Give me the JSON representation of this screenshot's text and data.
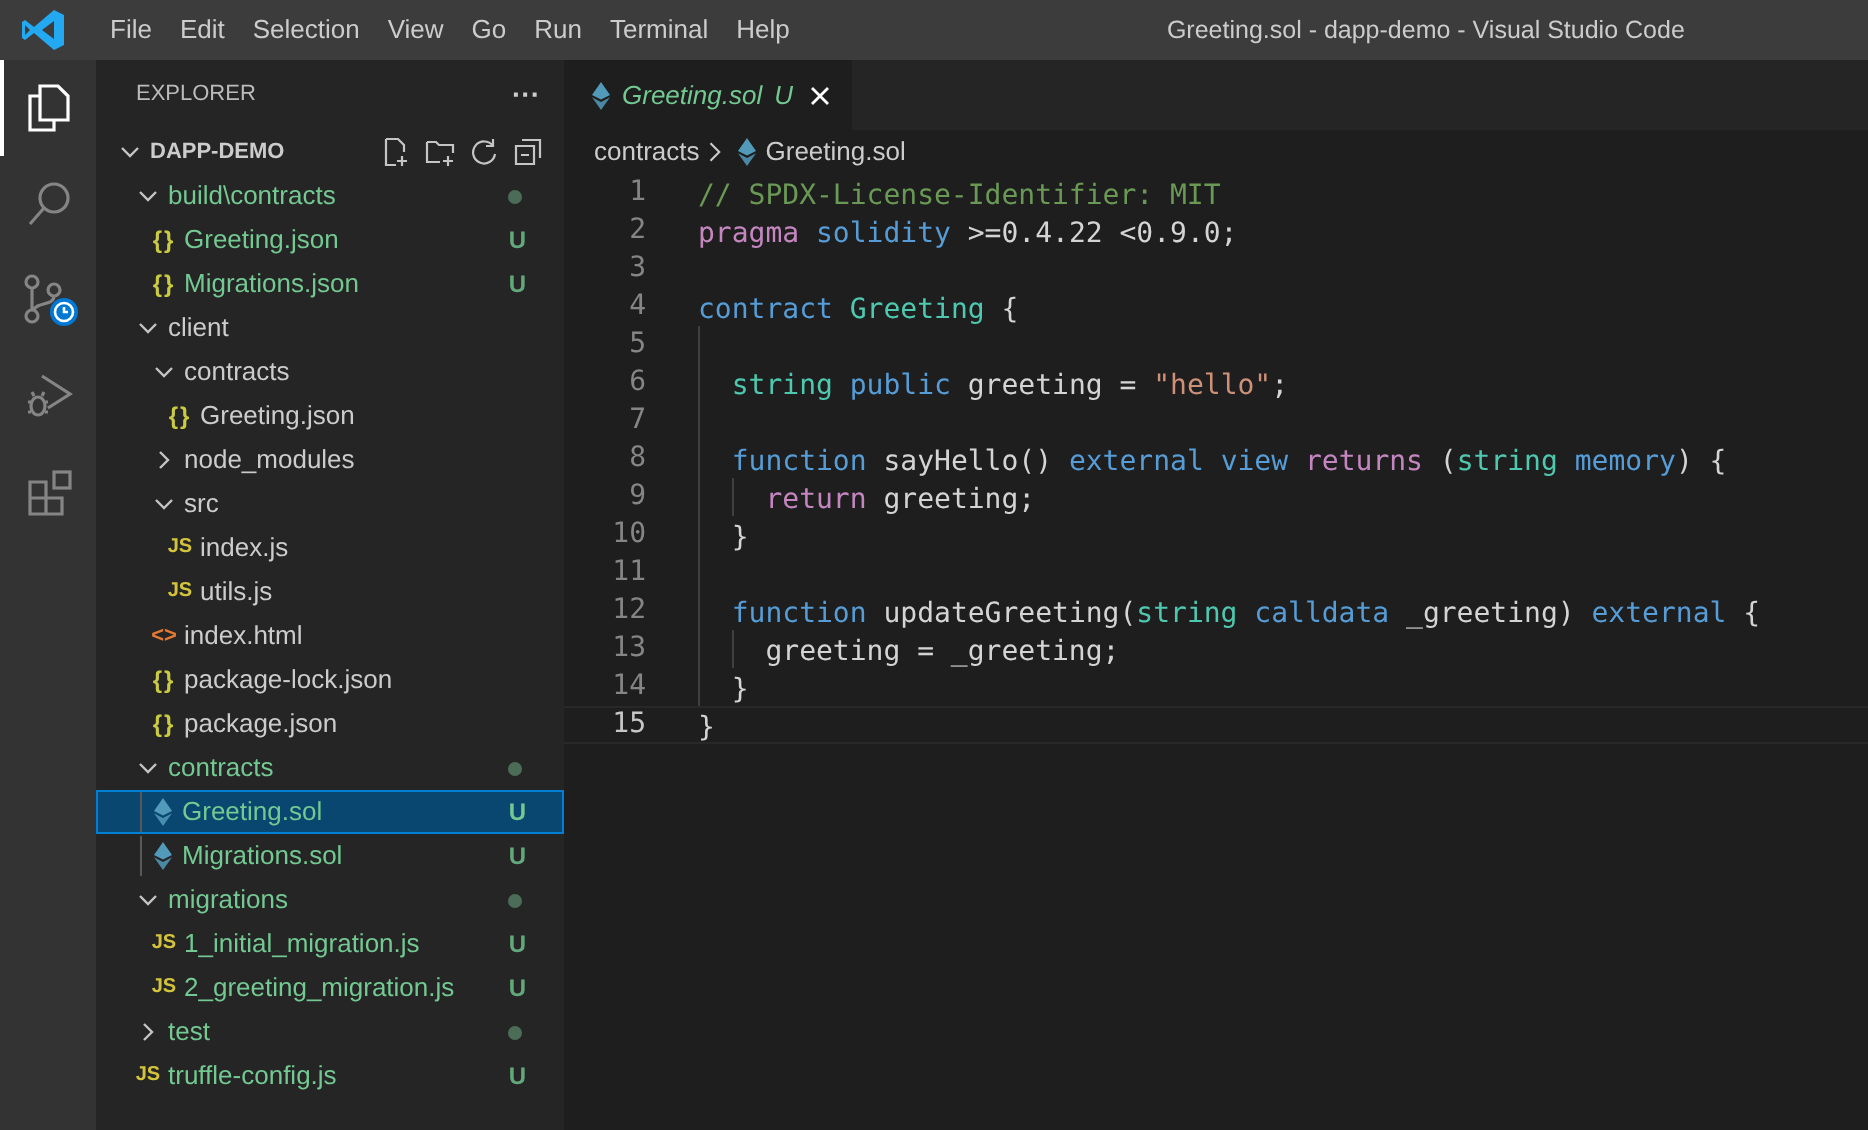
{
  "window": {
    "title": "Greeting.sol - dapp-demo - Visual Studio Code"
  },
  "menu": [
    "File",
    "Edit",
    "Selection",
    "View",
    "Go",
    "Run",
    "Terminal",
    "Help"
  ],
  "activity_bar": [
    {
      "kind": "explorer",
      "selected": true
    },
    {
      "kind": "search",
      "selected": false
    },
    {
      "kind": "source_control",
      "selected": false
    },
    {
      "kind": "debug",
      "selected": false
    },
    {
      "kind": "extensions",
      "selected": false
    }
  ],
  "explorer": {
    "title": "EXPLORER",
    "more": "···",
    "root": {
      "name": "DAPP-DEMO",
      "expanded": true,
      "children": [
        {
          "kind": "folder",
          "name": "build\\contracts",
          "expanded": true,
          "untracked": true,
          "dot": true,
          "selected": false,
          "children": [
            {
              "kind": "json_file",
              "icon": "{}",
              "name": "Greeting.json",
              "untracked": true,
              "badge": "U",
              "selected": false
            },
            {
              "kind": "json_file",
              "icon": "{}",
              "name": "Migrations.json",
              "untracked": true,
              "badge": "U",
              "selected": false
            }
          ]
        },
        {
          "kind": "folder",
          "name": "client",
          "expanded": true,
          "untracked": false,
          "dot": false,
          "selected": false,
          "children": [
            {
              "kind": "folder",
              "name": "contracts",
              "expanded": true,
              "untracked": false,
              "dot": false,
              "selected": false,
              "children": [
                {
                  "kind": "json_file",
                  "icon": "{}",
                  "name": "Greeting.json",
                  "untracked": false,
                  "selected": false
                }
              ]
            },
            {
              "kind": "folder",
              "name": "node_modules",
              "expanded": false,
              "untracked": false,
              "dot": false,
              "selected": false
            },
            {
              "kind": "folder",
              "name": "src",
              "expanded": true,
              "untracked": false,
              "dot": false,
              "selected": false,
              "children": [
                {
                  "kind": "js_file",
                  "icon": "JS",
                  "name": "index.js",
                  "untracked": false,
                  "selected": false
                },
                {
                  "kind": "js_file",
                  "icon": "JS",
                  "name": "utils.js",
                  "untracked": false,
                  "selected": false
                }
              ]
            },
            {
              "kind": "html_file",
              "icon": "<>",
              "name": "index.html",
              "untracked": false,
              "selected": false
            },
            {
              "kind": "json_file",
              "icon": "{}",
              "name": "package-lock.json",
              "untracked": false,
              "selected": false
            },
            {
              "kind": "json_file",
              "icon": "{}",
              "name": "package.json",
              "untracked": false,
              "selected": false
            }
          ]
        },
        {
          "kind": "folder",
          "name": "contracts",
          "expanded": true,
          "untracked": true,
          "dot": true,
          "selected": false,
          "children": [
            {
              "kind": "sol_file",
              "name": "Greeting.sol",
              "untracked": true,
              "badge": "U",
              "selected": true
            },
            {
              "kind": "sol_file",
              "name": "Migrations.sol",
              "untracked": true,
              "badge": "U",
              "selected": false
            }
          ]
        },
        {
          "kind": "folder",
          "name": "migrations",
          "expanded": true,
          "untracked": true,
          "dot": true,
          "selected": false,
          "children": [
            {
              "kind": "js_file",
              "icon": "JS",
              "name": "1_initial_migration.js",
              "untracked": true,
              "badge": "U",
              "selected": false
            },
            {
              "kind": "js_file",
              "icon": "JS",
              "name": "2_greeting_migration.js",
              "untracked": true,
              "badge": "U",
              "selected": false
            }
          ]
        },
        {
          "kind": "folder",
          "name": "test",
          "expanded": false,
          "untracked": true,
          "dot": true,
          "selected": false
        },
        {
          "kind": "js_file",
          "icon": "JS",
          "name": "truffle-config.js",
          "untracked": true,
          "badge": "U",
          "selected": false
        }
      ]
    }
  },
  "tabs": [
    {
      "kind": "sol_file",
      "label": "Greeting.sol",
      "badge": "U",
      "preview": true,
      "untracked": true,
      "selected": true
    }
  ],
  "breadcrumb": [
    {
      "kind": "folder",
      "label": "contracts"
    },
    {
      "kind": "sol_file",
      "label": "Greeting.sol"
    }
  ],
  "editor": {
    "lines": [
      {
        "number": "1",
        "current": false,
        "tokens": [
          {
            "kind": "comment",
            "text": "// SPDX-License-Identifier: MIT"
          }
        ]
      },
      {
        "number": "2",
        "current": false,
        "tokens": [
          {
            "kind": "control",
            "text": "pragma"
          },
          {
            "kind": "storage",
            "text": " solidity"
          },
          {
            "kind": "plain",
            "text": " >=0.4.22 <0.9.0;"
          }
        ]
      },
      {
        "number": "3",
        "current": false
      },
      {
        "number": "4",
        "current": false,
        "tokens": [
          {
            "kind": "storage",
            "text": "contract"
          },
          {
            "kind": "type",
            "text": " Greeting"
          },
          {
            "kind": "plain",
            "text": " {"
          }
        ]
      },
      {
        "number": "5",
        "current": false
      },
      {
        "number": "6",
        "current": false,
        "tokens": [
          {
            "kind": "type",
            "text": "  string"
          },
          {
            "kind": "storage",
            "text": " public"
          },
          {
            "kind": "plain",
            "text": " greeting = "
          },
          {
            "kind": "string",
            "text": "\"hello\""
          },
          {
            "kind": "plain",
            "text": ";"
          }
        ]
      },
      {
        "number": "7",
        "current": false
      },
      {
        "number": "8",
        "current": false,
        "tokens": [
          {
            "kind": "storage",
            "text": "  function"
          },
          {
            "kind": "plain",
            "text": " sayHello() "
          },
          {
            "kind": "storage",
            "text": "external"
          },
          {
            "kind": "storage",
            "text": " view"
          },
          {
            "kind": "control",
            "text": " returns"
          },
          {
            "kind": "plain",
            "text": " ("
          },
          {
            "kind": "type",
            "text": "string"
          },
          {
            "kind": "storage",
            "text": " memory"
          },
          {
            "kind": "plain",
            "text": ") {"
          }
        ]
      },
      {
        "number": "9",
        "current": false,
        "tokens": [
          {
            "kind": "control",
            "text": "    return"
          },
          {
            "kind": "plain",
            "text": " greeting;"
          }
        ]
      },
      {
        "number": "10",
        "current": false,
        "tokens": [
          {
            "kind": "plain",
            "text": "  }"
          }
        ]
      },
      {
        "number": "11",
        "current": false
      },
      {
        "number": "12",
        "current": false,
        "tokens": [
          {
            "kind": "storage",
            "text": "  function"
          },
          {
            "kind": "plain",
            "text": " updateGreeting("
          },
          {
            "kind": "type",
            "text": "string"
          },
          {
            "kind": "storage",
            "text": " calldata"
          },
          {
            "kind": "plain",
            "text": " _greeting) "
          },
          {
            "kind": "storage",
            "text": "external"
          },
          {
            "kind": "plain",
            "text": " {"
          }
        ]
      },
      {
        "number": "13",
        "current": false,
        "tokens": [
          {
            "kind": "plain",
            "text": "    greeting = _greeting;"
          }
        ]
      },
      {
        "number": "14",
        "current": false,
        "tokens": [
          {
            "kind": "plain",
            "text": "  }"
          }
        ]
      },
      {
        "number": "15",
        "current": true,
        "tokens": [
          {
            "kind": "plain",
            "text": "}"
          }
        ]
      }
    ]
  }
}
